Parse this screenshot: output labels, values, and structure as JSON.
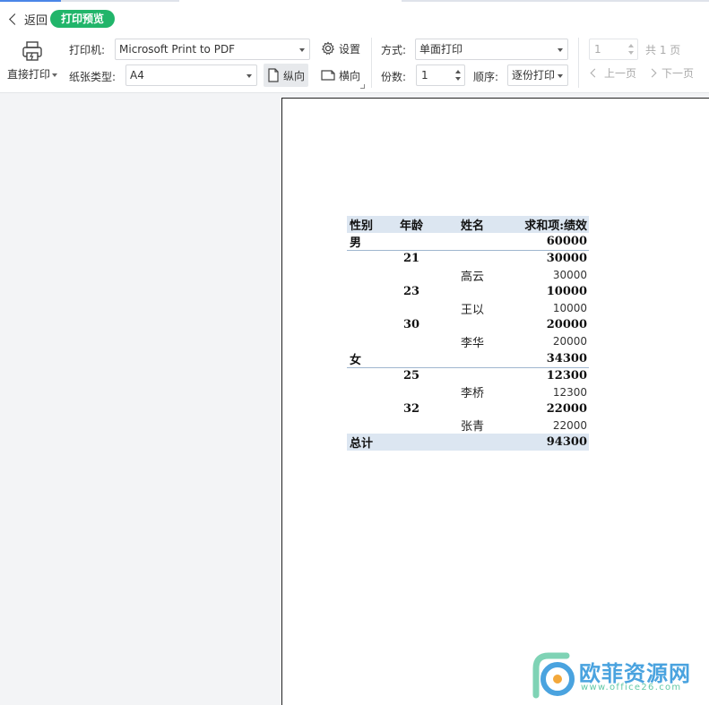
{
  "header": {
    "back_label": "返回",
    "mode_badge": "打印预览"
  },
  "toolbar": {
    "direct_print_label": "直接打印",
    "printer_label": "打印机:",
    "printer_value": "Microsoft Print to PDF",
    "settings_label": "设置",
    "paper_label": "纸张类型:",
    "paper_value": "A4",
    "portrait_label": "纵向",
    "landscape_label": "横向",
    "method_label": "方式:",
    "method_value": "单面打印",
    "copies_label": "份数:",
    "copies_value": "1",
    "order_label": "顺序:",
    "order_value": "逐份打印",
    "orientation_selected": "portrait"
  },
  "pager": {
    "current_page": "1",
    "total_label": "共 1 页",
    "prev_label": "上一页",
    "next_label": "下一页"
  },
  "table": {
    "headers": [
      "性别",
      "年龄",
      "姓名",
      "求和项:绩效"
    ],
    "rows": [
      {
        "level": "grp",
        "gender": "男",
        "age": "",
        "name": "",
        "value": "60000"
      },
      {
        "level": "sub",
        "gender": "",
        "age": "21",
        "name": "",
        "value": "30000"
      },
      {
        "level": "leaf",
        "gender": "",
        "age": "",
        "name": "高云",
        "value": "30000"
      },
      {
        "level": "sub",
        "gender": "",
        "age": "23",
        "name": "",
        "value": "10000"
      },
      {
        "level": "leaf",
        "gender": "",
        "age": "",
        "name": "王以",
        "value": "10000"
      },
      {
        "level": "sub",
        "gender": "",
        "age": "30",
        "name": "",
        "value": "20000"
      },
      {
        "level": "leaf",
        "gender": "",
        "age": "",
        "name": "李华",
        "value": "20000"
      },
      {
        "level": "grp",
        "gender": "女",
        "age": "",
        "name": "",
        "value": "34300"
      },
      {
        "level": "sub",
        "gender": "",
        "age": "25",
        "name": "",
        "value": "12300"
      },
      {
        "level": "leaf",
        "gender": "",
        "age": "",
        "name": "李桥",
        "value": "12300"
      },
      {
        "level": "sub",
        "gender": "",
        "age": "32",
        "name": "",
        "value": "22000"
      },
      {
        "level": "leaf",
        "gender": "",
        "age": "",
        "name": "张青",
        "value": "22000"
      }
    ],
    "total_label": "总计",
    "total_value": "94300"
  },
  "watermark": {
    "title": "欧菲资源网",
    "url": "www.office26.com"
  },
  "colors": {
    "accent_green": "#21b56a",
    "header_fill": "#dce6f1",
    "watermark_blue": "#4aa3df",
    "watermark_green": "#62c9a6"
  }
}
